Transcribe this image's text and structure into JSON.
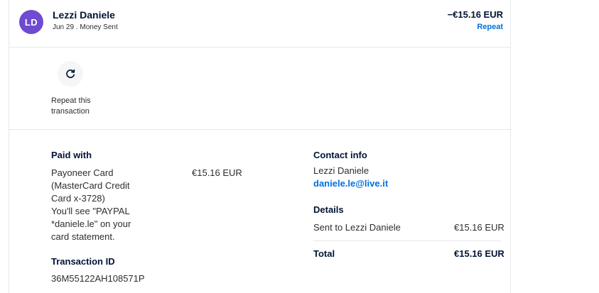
{
  "transaction": {
    "avatar_initials": "LD",
    "name": "Lezzi Daniele",
    "meta": "Jun 29 . Money Sent",
    "amount": "−€15.16 EUR",
    "repeat_link": "Repeat"
  },
  "repeat_action": {
    "label": "Repeat this transaction"
  },
  "paid_with": {
    "title": "Paid with",
    "method_lines": [
      "Payoneer Card",
      "(MasterCard Credit",
      "Card x-3728)",
      "You'll see \"PAYPAL",
      "*daniele.le\" on your",
      "card statement."
    ],
    "amount": "€15.16 EUR"
  },
  "transaction_id": {
    "title": "Transaction ID",
    "value": "36M55122AH108571P"
  },
  "contact": {
    "title": "Contact info",
    "name": "Lezzi Daniele",
    "email": "daniele.le@live.it"
  },
  "details": {
    "title": "Details",
    "sent_to_label": "Sent to Lezzi Daniele",
    "sent_to_amount": "€15.16 EUR",
    "total_label": "Total",
    "total_amount": "€15.16 EUR"
  },
  "colors": {
    "avatar": "#6e4bd1",
    "link": "#0070e0",
    "text_dark": "#001435"
  },
  "icons": {
    "repeat": "refresh-icon"
  }
}
